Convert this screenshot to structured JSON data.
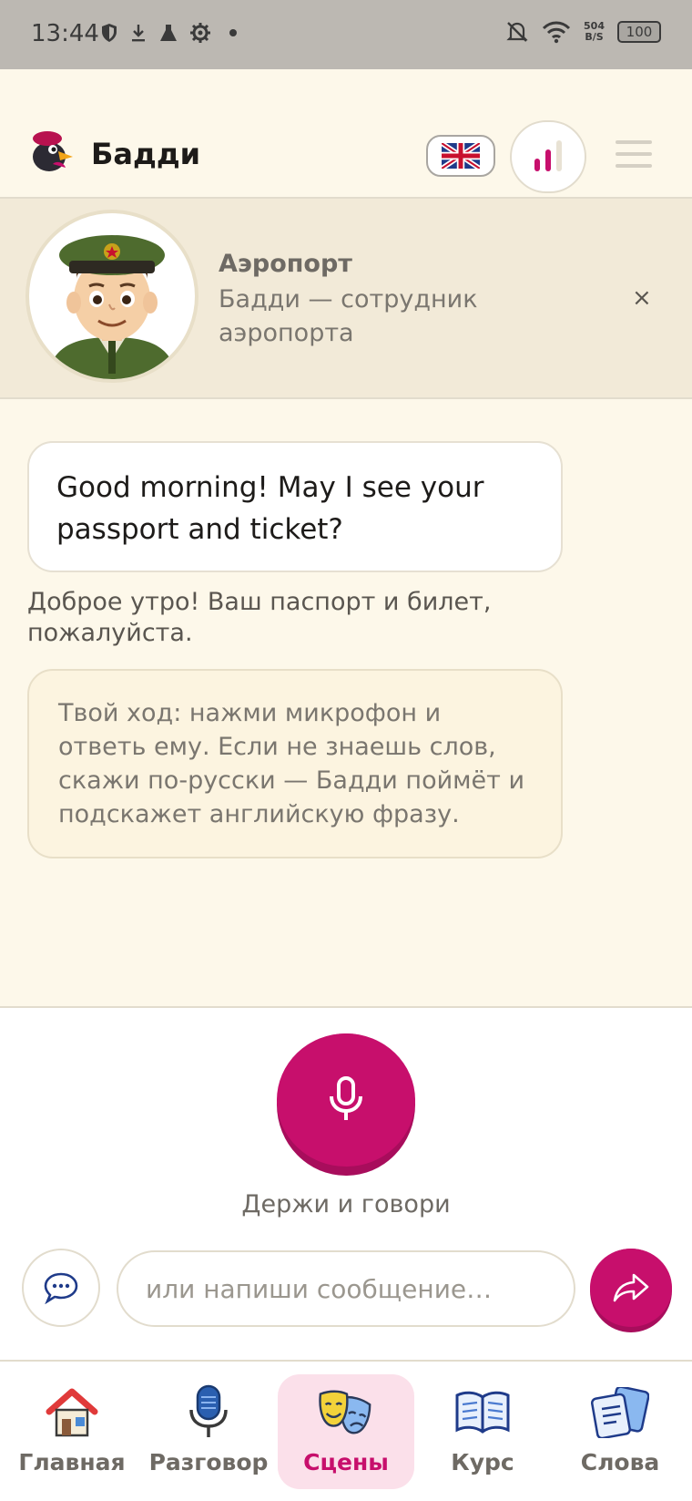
{
  "status_bar": {
    "time": "13:44",
    "left_icons": [
      "shield-icon",
      "download-icon",
      "flask-icon",
      "gear-icon",
      "dot-icon"
    ],
    "right_icons": [
      "bell-off-icon",
      "wifi-icon"
    ],
    "net_speed_value": "504",
    "net_speed_unit": "B/S",
    "battery": "100"
  },
  "header": {
    "title": "Бадди",
    "language_icon": "uk-flag-icon",
    "level_icon": "signal-bars-icon",
    "menu_icon": "hamburger-icon"
  },
  "scene": {
    "title": "Аэропорт",
    "description": "Бадди — сотрудник аэропорта",
    "close_label": "×"
  },
  "chat": {
    "bot_message": "Good morning! May I see your passport and ticket?",
    "bot_translation": "Доброе утро! Ваш паспорт и билет, пожалуйста.",
    "hint": "Твой ход: нажми микрофон и ответь ему. Если не знаешь слов, скажи по-русски — Бадди поймёт и подскажет английскую фразу."
  },
  "input": {
    "mic_label": "Держи и говори",
    "placeholder": "или напиши сообщение…"
  },
  "nav": {
    "items": [
      {
        "label": "Главная",
        "icon": "house-icon"
      },
      {
        "label": "Разговор",
        "icon": "microphone-icon"
      },
      {
        "label": "Сцены",
        "icon": "theater-masks-icon"
      },
      {
        "label": "Курс",
        "icon": "book-icon"
      },
      {
        "label": "Слова",
        "icon": "cards-icon"
      }
    ],
    "active": "Сцены"
  },
  "colors": {
    "accent": "#c70f6c",
    "background": "#fdf8ea",
    "banner": "#f2ead8"
  }
}
